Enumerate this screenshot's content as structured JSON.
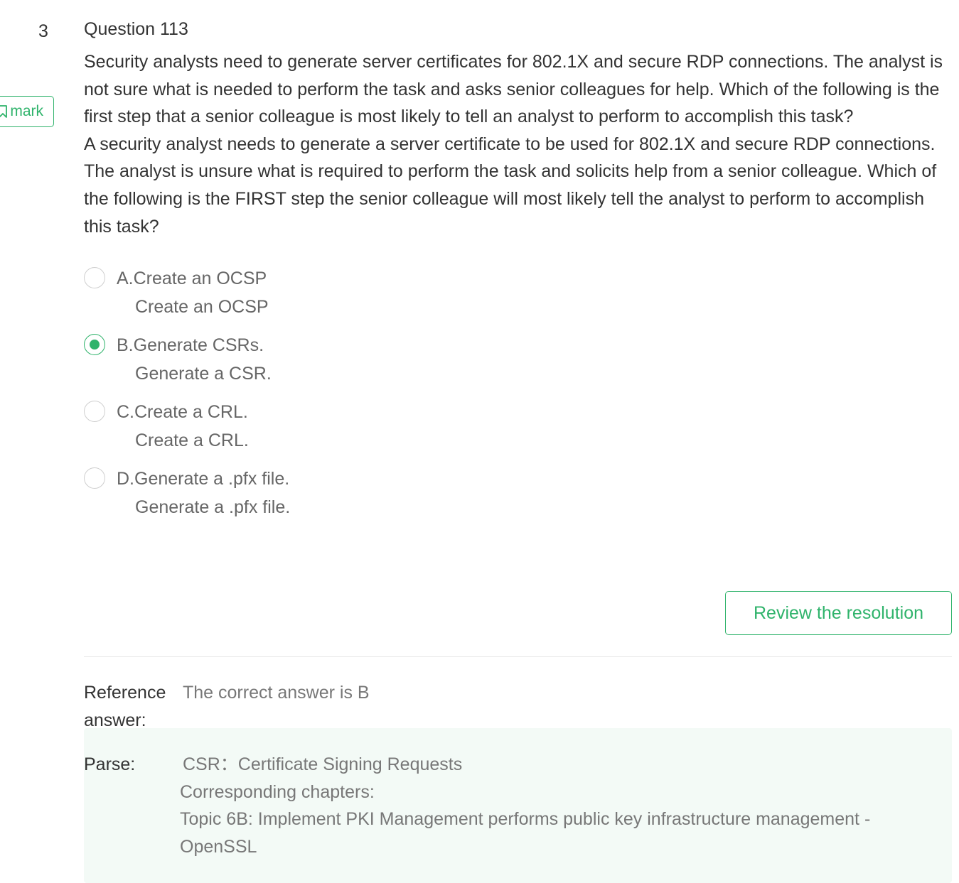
{
  "question": {
    "index": "3",
    "title": "Question 113",
    "text_1": "Security analysts need to generate server certificates for 802.1X and secure RDP connections. The analyst is not sure what is needed to perform the task and asks senior colleagues for help. Which of the following is the first step that a senior colleague is most likely to tell an analyst to perform to accomplish this task?",
    "text_2": "A security analyst needs to generate a server certificate to be used for 802.1X and secure RDP connections. The analyst is unsure what is required to perform the task and solicits help from a senior colleague. Which of the following is the FIRST step the senior colleague will most likely tell the analyst to perform to accomplish this task?"
  },
  "mark_button": {
    "label": "mark",
    "icon": "bookmark-icon"
  },
  "options": [
    {
      "label": "A.Create an OCSP",
      "sub": "Create an OCSP",
      "selected": false
    },
    {
      "label": "B.Generate CSRs.",
      "sub": "Generate a CSR.",
      "selected": true
    },
    {
      "label": "C.Create a CRL.",
      "sub": "Create a CRL.",
      "selected": false
    },
    {
      "label": "D.Generate a .pfx file.",
      "sub": "Generate a .pfx file.",
      "selected": false
    }
  ],
  "review_button": {
    "label": "Review the resolution"
  },
  "reference": {
    "label": "Reference answer:",
    "value": "The correct answer is B"
  },
  "parse": {
    "label": "Parse:",
    "line_1": "CSR：Certificate Signing Requests",
    "line_2": "Corresponding chapters:",
    "line_3": "Topic 6B: Implement PKI Management performs public key infrastructure management - OpenSSL"
  },
  "colors": {
    "accent": "#2fb36b",
    "parse_background": "#f3faf6",
    "text": "#333333",
    "muted_text": "#666666"
  }
}
